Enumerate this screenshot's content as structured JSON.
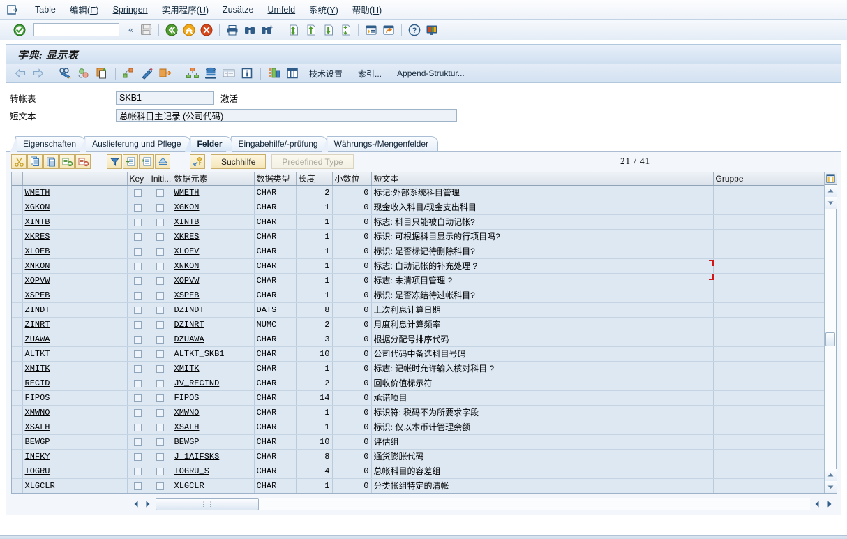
{
  "menubar": {
    "system_icon": "system-menu-icon",
    "items": [
      {
        "label": "Table",
        "mnemonic": ""
      },
      {
        "label": "编辑",
        "mnemonic": "E"
      },
      {
        "label": "Springen",
        "mnemonic": "S"
      },
      {
        "label": "实用程序",
        "mnemonic": "U"
      },
      {
        "label": "Zusätze",
        "mnemonic": ""
      },
      {
        "label": "Umfeld",
        "mnemonic": "U"
      },
      {
        "label": "系统",
        "mnemonic": "Y"
      },
      {
        "label": "帮助",
        "mnemonic": "H"
      }
    ]
  },
  "toolbar": {
    "ok_icon": "green-check-icon",
    "command_value": "",
    "command_placeholder": "",
    "dropdown_icon": "chevron-down-icon",
    "collapse_icon": "double-chevron-left-icon",
    "buttons": [
      {
        "name": "save-button",
        "icon": "save-disk-icon",
        "disabled": true
      },
      {
        "name": "back-button",
        "icon": "green-back-arrow-icon",
        "disabled": false
      },
      {
        "name": "exit-button",
        "icon": "yellow-up-arrow-icon",
        "disabled": false
      },
      {
        "name": "cancel-button",
        "icon": "red-cancel-icon",
        "disabled": false
      },
      {
        "name": "print-button",
        "icon": "printer-icon",
        "disabled": false
      },
      {
        "name": "find-button",
        "icon": "binoculars-icon",
        "disabled": false
      },
      {
        "name": "find-next-button",
        "icon": "binoculars-plus-icon",
        "disabled": false
      },
      {
        "name": "first-page-button",
        "icon": "page-first-icon",
        "disabled": false
      },
      {
        "name": "previous-page-button",
        "icon": "page-up-icon",
        "disabled": false
      },
      {
        "name": "next-page-button",
        "icon": "page-down-icon",
        "disabled": false
      },
      {
        "name": "last-page-button",
        "icon": "page-last-icon",
        "disabled": false
      },
      {
        "name": "create-session-button",
        "icon": "new-session-icon",
        "disabled": false
      },
      {
        "name": "create-shortcut-button",
        "icon": "shortcut-icon",
        "disabled": false
      },
      {
        "name": "help-button",
        "icon": "question-help-icon",
        "disabled": false
      },
      {
        "name": "customize-layout-button",
        "icon": "monitor-layout-icon",
        "disabled": false
      }
    ]
  },
  "screen": {
    "title": "字典: 显示表"
  },
  "apptoolbar": {
    "icon_buttons": [
      {
        "name": "previous-object-button",
        "icon": "left-arrow-icon"
      },
      {
        "name": "next-object-button",
        "icon": "right-arrow-icon"
      },
      {
        "name": "display-change-button",
        "icon": "glasses-pencil-icon"
      },
      {
        "name": "other-object-button",
        "icon": "other-object-icon"
      },
      {
        "name": "copy-object-button",
        "icon": "copy-clipboard-icon"
      },
      {
        "name": "hierarchy-display-button",
        "icon": "where-used-icon"
      },
      {
        "name": "check-button",
        "icon": "magic-wand-icon"
      },
      {
        "name": "activate-button",
        "icon": "activate-arrow-icon"
      },
      {
        "name": "structure-hierarchy-button",
        "icon": "structure-tree-icon"
      },
      {
        "name": "database-utility-button",
        "icon": "database-stack-icon"
      },
      {
        "name": "display-data-button",
        "icon": "table-contents-icon"
      },
      {
        "name": "info-button",
        "icon": "info-blue-icon"
      },
      {
        "name": "field-arrangement-button",
        "icon": "field-arrangement-icon"
      },
      {
        "name": "columns-button",
        "icon": "columns-icon"
      }
    ],
    "text_buttons": [
      {
        "name": "technical-settings-button",
        "label": "技术设置"
      },
      {
        "name": "indexes-button",
        "label": "索引..."
      },
      {
        "name": "append-structure-button",
        "label": "Append-Struktur..."
      }
    ]
  },
  "form": {
    "transp_table_label": "转帐表",
    "transp_table_value": "SKB1",
    "status_text": "激活",
    "short_text_label": "短文本",
    "short_text_value": "总帐科目主记录 (公司代码)"
  },
  "tabs": [
    {
      "name": "tab-eigenschaften",
      "label": "Eigenschaften",
      "active": false
    },
    {
      "name": "tab-auslieferung",
      "label": "Auslieferung und Pflege",
      "active": false
    },
    {
      "name": "tab-felder",
      "label": "Felder",
      "active": true
    },
    {
      "name": "tab-eingabehilfe",
      "label": "Eingabehilfe/-prüfung",
      "active": false
    },
    {
      "name": "tab-waehrungs",
      "label": "Währungs-/Mengenfelder",
      "active": false
    }
  ],
  "table_toolbar": {
    "buttons": [
      {
        "name": "cut-button",
        "icon": "scissors-icon",
        "disabled": false
      },
      {
        "name": "copy-button",
        "icon": "copy-icon",
        "disabled": false
      },
      {
        "name": "paste-button",
        "icon": "paste-icon",
        "disabled": false
      },
      {
        "name": "insert-row-button",
        "icon": "insert-row-icon",
        "disabled": false
      },
      {
        "name": "delete-row-button",
        "icon": "delete-row-icon",
        "disabled": false
      },
      {
        "name": "sort-filter-button",
        "icon": "filter-down-icon",
        "disabled": false
      },
      {
        "name": "append-row-button",
        "icon": "append-row-icon",
        "disabled": false
      },
      {
        "name": "insert-line-button",
        "icon": "insert-line-icon",
        "disabled": false
      },
      {
        "name": "expand-button",
        "icon": "expand-up-icon",
        "disabled": false
      },
      {
        "name": "data-element-button",
        "icon": "key-drilldown-icon",
        "disabled": false
      }
    ],
    "search_help_label": "Suchhilfe",
    "predefined_type_label": "Predefined Type",
    "predefined_type_disabled": true,
    "counter": "21  /  41"
  },
  "grid": {
    "columns": [
      {
        "name": "col-rowheader",
        "label": ""
      },
      {
        "name": "col-field",
        "label": ""
      },
      {
        "name": "col-key",
        "label": "Key"
      },
      {
        "name": "col-initial",
        "label": "Initi..."
      },
      {
        "name": "col-data-element",
        "label": "数据元素"
      },
      {
        "name": "col-data-type",
        "label": "数据类型"
      },
      {
        "name": "col-length",
        "label": "长度"
      },
      {
        "name": "col-decimals",
        "label": "小数位"
      },
      {
        "name": "col-short-text",
        "label": "短文本"
      },
      {
        "name": "col-group",
        "label": "Gruppe"
      }
    ],
    "column_config_icon": "column-config-icon",
    "rows": [
      {
        "field": "WMETH",
        "key": false,
        "initial": false,
        "data_element": "WMETH",
        "data_type": "CHAR",
        "length": "2",
        "decimals": "0",
        "short_text": "标记:外部系统科目管理",
        "group": ""
      },
      {
        "field": "XGKON",
        "key": false,
        "initial": false,
        "data_element": "XGKON",
        "data_type": "CHAR",
        "length": "1",
        "decimals": "0",
        "short_text": "现金收入科目/现金支出科目",
        "group": ""
      },
      {
        "field": "XINTB",
        "key": false,
        "initial": false,
        "data_element": "XINTB",
        "data_type": "CHAR",
        "length": "1",
        "decimals": "0",
        "short_text": "标志: 科目只能被自动记帐?",
        "group": ""
      },
      {
        "field": "XKRES",
        "key": false,
        "initial": false,
        "data_element": "XKRES",
        "data_type": "CHAR",
        "length": "1",
        "decimals": "0",
        "short_text": "标识: 可根据科目显示的行项目吗?",
        "group": ""
      },
      {
        "field": "XLOEB",
        "key": false,
        "initial": false,
        "data_element": "XLOEV",
        "data_type": "CHAR",
        "length": "1",
        "decimals": "0",
        "short_text": "标识: 是否标记待删除科目?",
        "group": ""
      },
      {
        "field": "XNKON",
        "key": false,
        "initial": false,
        "data_element": "XNKON",
        "data_type": "CHAR",
        "length": "1",
        "decimals": "0",
        "short_text": "标志: 自动记帐的补充处理 ?",
        "group": ""
      },
      {
        "field": "XOPVW",
        "key": false,
        "initial": false,
        "data_element": "XOPVW",
        "data_type": "CHAR",
        "length": "1",
        "decimals": "0",
        "short_text": "标志: 未清项目管理 ?",
        "group": ""
      },
      {
        "field": "XSPEB",
        "key": false,
        "initial": false,
        "data_element": "XSPEB",
        "data_type": "CHAR",
        "length": "1",
        "decimals": "0",
        "short_text": "标识: 是否冻结待过帐科目?",
        "group": ""
      },
      {
        "field": "ZINDT",
        "key": false,
        "initial": false,
        "data_element": "DZINDT",
        "data_type": "DATS",
        "length": "8",
        "decimals": "0",
        "short_text": "上次利息计算日期",
        "group": ""
      },
      {
        "field": "ZINRT",
        "key": false,
        "initial": false,
        "data_element": "DZINRT",
        "data_type": "NUMC",
        "length": "2",
        "decimals": "0",
        "short_text": "月度利息计算频率",
        "group": ""
      },
      {
        "field": "ZUAWA",
        "key": false,
        "initial": false,
        "data_element": "DZUAWA",
        "data_type": "CHAR",
        "length": "3",
        "decimals": "0",
        "short_text": "根据分配号排序代码",
        "group": ""
      },
      {
        "field": "ALTKT",
        "key": false,
        "initial": false,
        "data_element": "ALTKT_SKB1",
        "data_type": "CHAR",
        "length": "10",
        "decimals": "0",
        "short_text": "公司代码中备选科目号码",
        "group": ""
      },
      {
        "field": "XMITK",
        "key": false,
        "initial": false,
        "data_element": "XMITK",
        "data_type": "CHAR",
        "length": "1",
        "decimals": "0",
        "short_text": "标志: 记帐时允许输入核对科目 ?",
        "group": ""
      },
      {
        "field": "RECID",
        "key": false,
        "initial": false,
        "data_element": "JV_RECIND",
        "data_type": "CHAR",
        "length": "2",
        "decimals": "0",
        "short_text": "回收价值标示符",
        "group": ""
      },
      {
        "field": "FIPOS",
        "key": false,
        "initial": false,
        "data_element": "FIPOS",
        "data_type": "CHAR",
        "length": "14",
        "decimals": "0",
        "short_text": "承诺项目",
        "group": ""
      },
      {
        "field": "XMWNO",
        "key": false,
        "initial": false,
        "data_element": "XMWNO",
        "data_type": "CHAR",
        "length": "1",
        "decimals": "0",
        "short_text": "标识符: 税码不为所要求字段",
        "group": ""
      },
      {
        "field": "XSALH",
        "key": false,
        "initial": false,
        "data_element": "XSALH",
        "data_type": "CHAR",
        "length": "1",
        "decimals": "0",
        "short_text": "标识: 仅以本币计管理余额",
        "group": ""
      },
      {
        "field": "BEWGP",
        "key": false,
        "initial": false,
        "data_element": "BEWGP",
        "data_type": "CHAR",
        "length": "10",
        "decimals": "0",
        "short_text": "评估组",
        "group": ""
      },
      {
        "field": "INFKY",
        "key": false,
        "initial": false,
        "data_element": "J_1AIFSKS",
        "data_type": "CHAR",
        "length": "8",
        "decimals": "0",
        "short_text": "通货膨胀代码",
        "group": ""
      },
      {
        "field": "TOGRU",
        "key": false,
        "initial": false,
        "data_element": "TOGRU_S",
        "data_type": "CHAR",
        "length": "4",
        "decimals": "0",
        "short_text": "总帐科目的容差组",
        "group": ""
      },
      {
        "field": "XLGCLR",
        "key": false,
        "initial": false,
        "data_element": "XLGCLR",
        "data_type": "CHAR",
        "length": "1",
        "decimals": "0",
        "short_text": "分类帐组特定的清帐",
        "group": ""
      }
    ]
  },
  "scrollbars": {
    "v_up_icon": "scroll-up-icon",
    "v_down_icon": "scroll-down-icon",
    "h_left_icon": "scroll-left-icon",
    "h_right_icon": "scroll-right-icon",
    "grip": "⋮⋮"
  }
}
